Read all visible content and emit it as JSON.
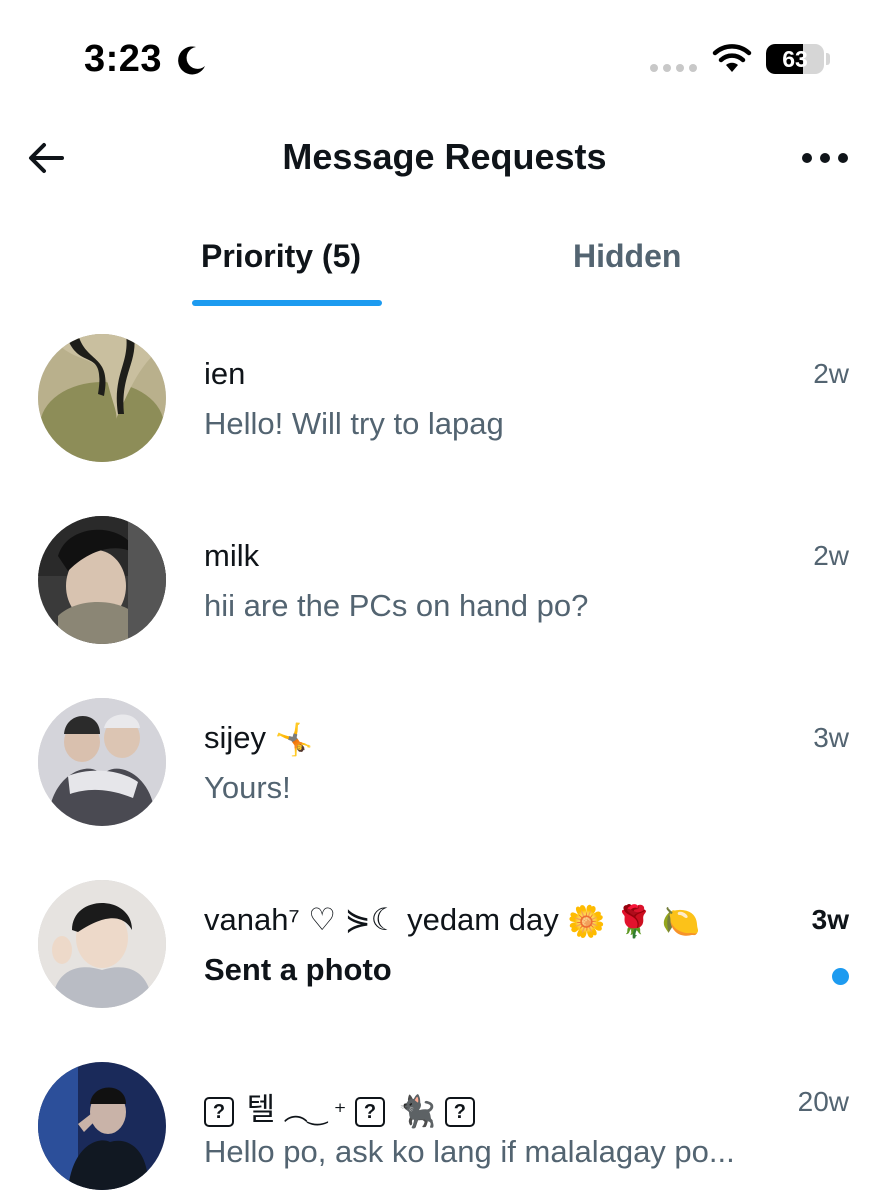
{
  "status_bar": {
    "time": "3:23",
    "battery_level": 63,
    "battery_text": "63",
    "icons": [
      "moon-icon",
      "signal-dots",
      "wifi-icon",
      "battery-icon"
    ]
  },
  "header": {
    "title": "Message Requests",
    "back_icon": "arrow-left-icon",
    "more_icon": "ellipsis-icon"
  },
  "tabs": [
    {
      "label": "Priority (5)",
      "active": true
    },
    {
      "label": "Hidden",
      "active": false
    }
  ],
  "conversations": [
    {
      "name": "ien",
      "snippet": "Hello! Will try to lapag",
      "time": "2w",
      "unread": false
    },
    {
      "name": "milk",
      "snippet": "hii are the PCs on hand po?",
      "time": "2w",
      "unread": false
    },
    {
      "name": "sijey",
      "name_emoji": "🤸",
      "snippet": "Yours!",
      "time": "3w",
      "unread": false
    },
    {
      "name": "vanah⁷ ♡ ⋟☾ yedam day",
      "name_emoji": "🌼 🌹 🍋",
      "snippet": "Sent a photo",
      "time": "3w",
      "unread": true
    },
    {
      "name": "텔",
      "name_prefix": "?",
      "name_decoration": "︵‿ ⁺",
      "name_emoji": "🐈‍⬛",
      "snippet": "Hello po, ask ko lang if malalagay po...",
      "time": "20w",
      "unread": false
    }
  ],
  "colors": {
    "accent": "#1d9bf0",
    "text_primary": "#0f1419",
    "text_secondary": "#536471",
    "background": "#ffffff"
  }
}
